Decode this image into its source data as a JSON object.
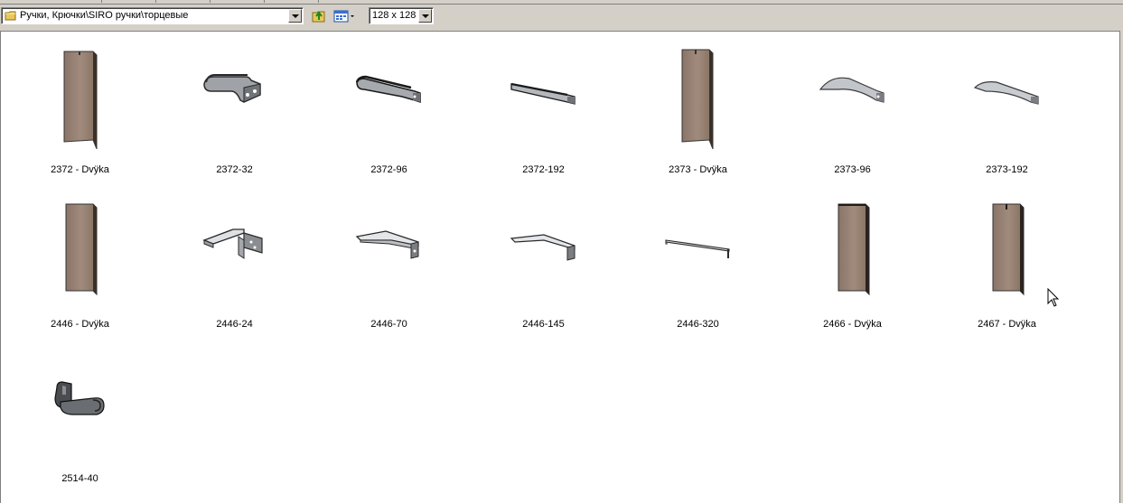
{
  "toolbar": {
    "path": "Ручки, Крючки\\SIRO ручки\\торцевые",
    "thumbnail_size": "128 x 128"
  },
  "items": [
    {
      "label": "2372 - Dvÿka",
      "icon": "door-panel-icon"
    },
    {
      "label": "2372-32",
      "icon": "handle-short-icon"
    },
    {
      "label": "2372-96",
      "icon": "handle-medium-icon"
    },
    {
      "label": "2372-192",
      "icon": "handle-long-icon"
    },
    {
      "label": "2373 - Dvÿka",
      "icon": "door-panel-icon"
    },
    {
      "label": "2373-96",
      "icon": "handle-curved-icon"
    },
    {
      "label": "2373-192",
      "icon": "handle-curved-long-icon"
    },
    {
      "label": "2446 - Dvÿka",
      "icon": "door-panel-icon"
    },
    {
      "label": "2446-24",
      "icon": "handle-bracket-icon"
    },
    {
      "label": "2446-70",
      "icon": "handle-flat-icon"
    },
    {
      "label": "2446-145",
      "icon": "handle-flat-long-icon"
    },
    {
      "label": "2446-320",
      "icon": "handle-rail-icon"
    },
    {
      "label": "2466 - Dvÿka",
      "icon": "door-panel-icon"
    },
    {
      "label": "2467 - Dvÿka",
      "icon": "door-panel-icon"
    },
    {
      "label": "2514-40",
      "icon": "hook-handle-icon"
    }
  ]
}
